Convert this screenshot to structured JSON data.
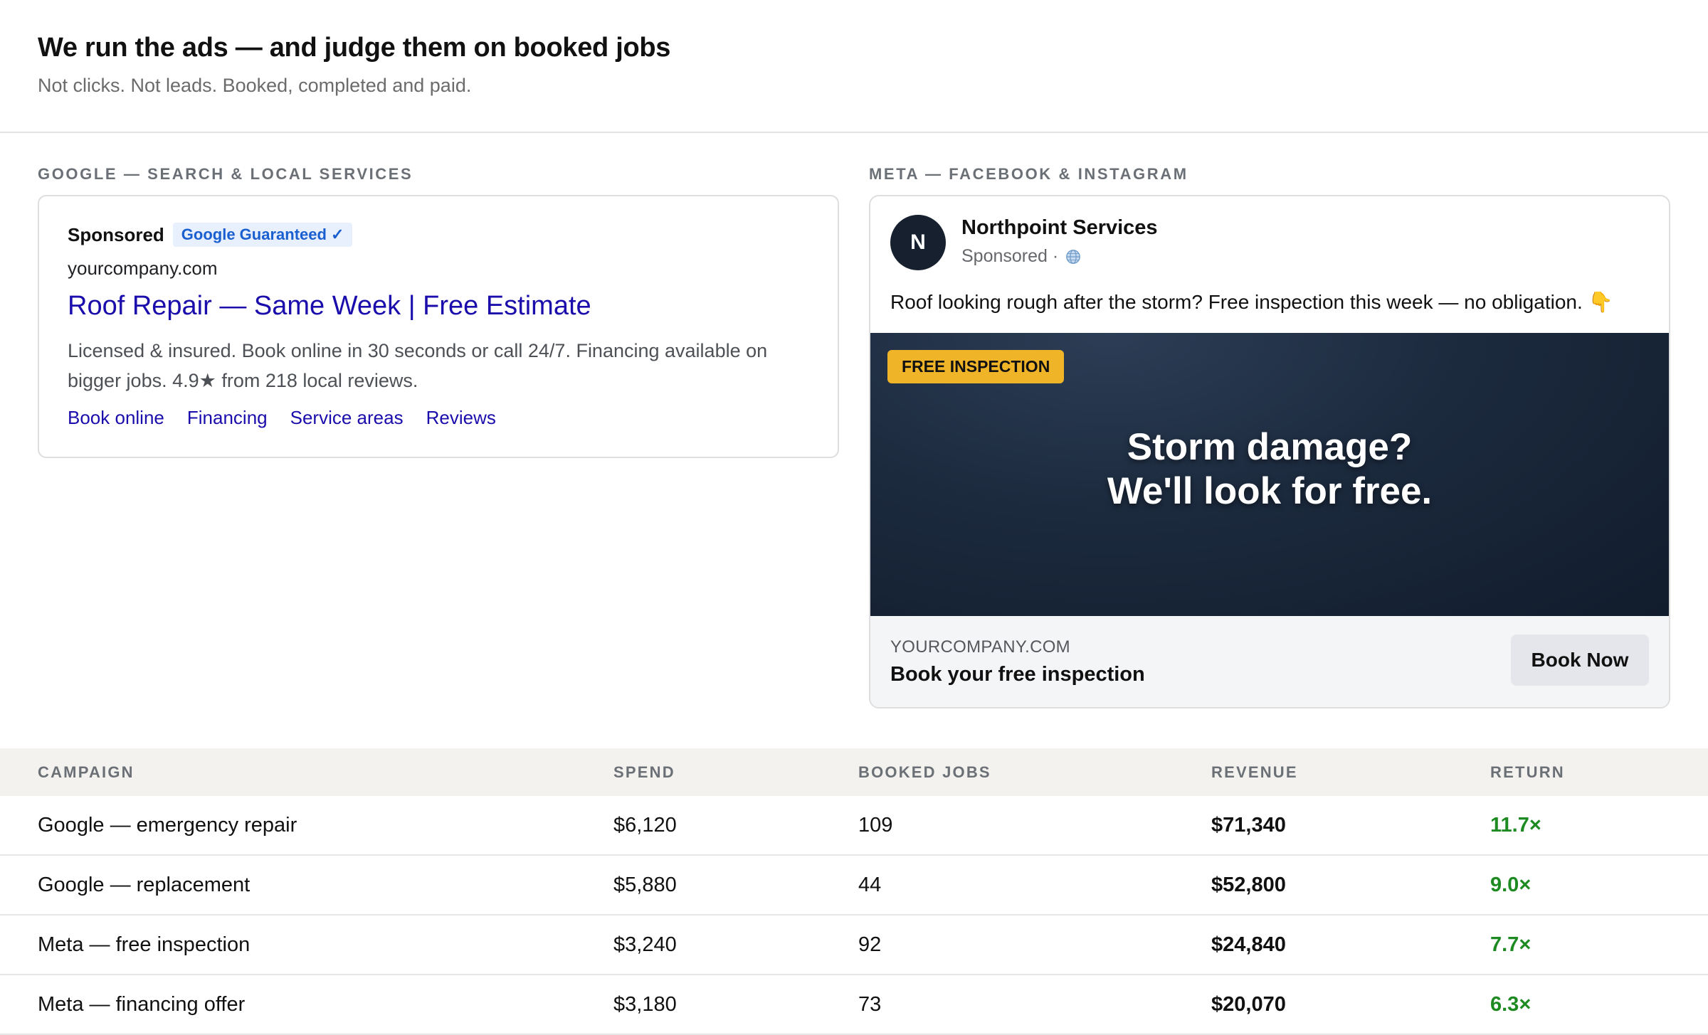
{
  "header": {
    "title": "We run the ads — and judge them on booked jobs",
    "subtitle": "Not clicks. Not leads. Booked, completed and paid."
  },
  "google": {
    "section_label": "GOOGLE — SEARCH & LOCAL SERVICES",
    "sponsored": "Sponsored",
    "badge": "Google Guaranteed",
    "badge_check": "✓",
    "domain": "yourcompany.com",
    "headline": "Roof Repair — Same Week | Free Estimate",
    "description": "Licensed & insured. Book online in 30 seconds or call 24/7. Financing available on bigger jobs. 4.9★ from 218 local reviews.",
    "sitelinks": [
      "Book online",
      "Financing",
      "Service areas",
      "Reviews"
    ]
  },
  "meta": {
    "section_label": "META — FACEBOOK & INSTAGRAM",
    "avatar_initial": "N",
    "page_name": "Northpoint Services",
    "sponsored": "Sponsored ·",
    "post_text": "Roof looking rough after the storm? Free inspection this week — no obligation. 👇",
    "image_tag": "FREE INSPECTION",
    "image_headline_1": "Storm damage?",
    "image_headline_2": "We'll look for free.",
    "site": "YOURCOMPANY.COM",
    "cta_text": "Book your free inspection",
    "button": "Book Now"
  },
  "table": {
    "headers": [
      "CAMPAIGN",
      "SPEND",
      "BOOKED JOBS",
      "REVENUE",
      "RETURN"
    ],
    "rows": [
      [
        "Google — emergency repair",
        "$6,120",
        "109",
        "$71,340",
        "11.7×"
      ],
      [
        "Google — replacement",
        "$5,880",
        "44",
        "$52,800",
        "9.0×"
      ],
      [
        "Meta — free inspection",
        "$3,240",
        "92",
        "$24,840",
        "7.7×"
      ],
      [
        "Meta — financing offer",
        "$3,180",
        "73",
        "$20,070",
        "6.3×"
      ]
    ]
  },
  "colors": {
    "google_link": "#1a0dab",
    "badge_blue": "#1a5fd0",
    "return_green": "#1e8a22",
    "tag_yellow": "#f0b429",
    "ad_image_dark": "#16202e"
  }
}
